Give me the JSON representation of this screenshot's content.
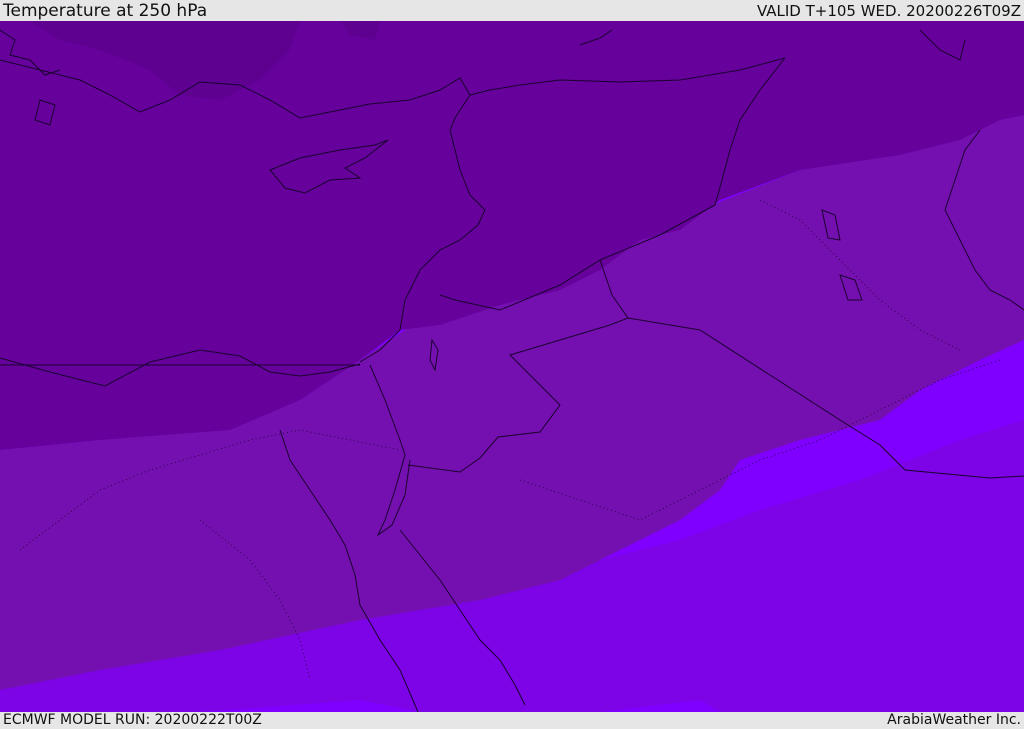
{
  "header": {
    "title": "Temperature at 250 hPa",
    "valid": "VALID T+105 WED. 20200226T09Z"
  },
  "footer": {
    "model_run": "ECMWF MODEL RUN: 20200222T00Z",
    "credit": "ArabiaWeather Inc."
  },
  "colors": {
    "band_darkest": "#5e0191",
    "band_dark": "#66019c",
    "band_mid": "#7510b0",
    "band_bright": "#7c04e6",
    "band_brightest": "#7f00ff",
    "band_blue": "#6a1cff",
    "coastline": "#1a0030",
    "background": "#e6e6e6"
  }
}
